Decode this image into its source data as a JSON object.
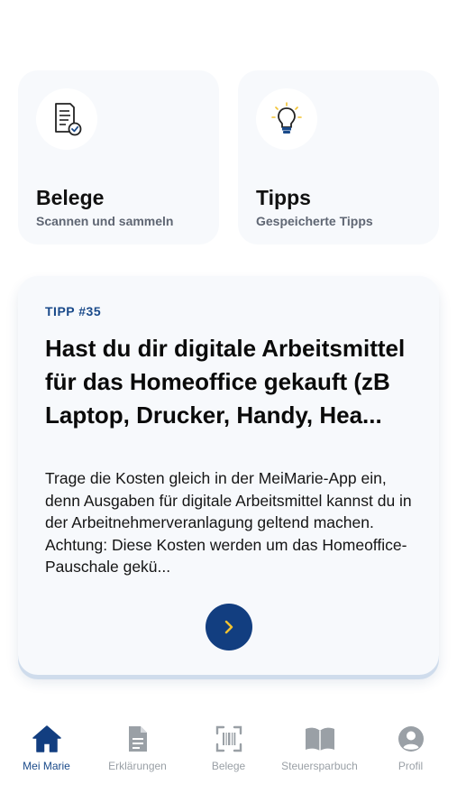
{
  "cards": [
    {
      "title": "Belege",
      "subtitle": "Scannen und sammeln",
      "icon": "receipt-check-icon"
    },
    {
      "title": "Tipps",
      "subtitle": "Gespeicherte Tipps",
      "icon": "lightbulb-icon"
    }
  ],
  "tip": {
    "label": "TIPP #35",
    "headline": "Hast du dir digitale Arbeitsmittel für das Homeoffice gekauft (zB Laptop, Drucker, Handy, Hea...",
    "body": "Trage die Kosten gleich in der MeiMarie-App ein, denn Ausgaben für digitale Arbeitsmittel kannst du in der Arbeitnehmerveranlagung geltend machen. Achtung: Diese Kosten werden um das Homeoffice-Pauschale gekü...",
    "next_icon": "chevron-right-icon"
  },
  "tabbar": {
    "items": [
      {
        "label": "Mei Marie",
        "icon": "home-icon",
        "active": true
      },
      {
        "label": "Erklärungen",
        "icon": "document-icon",
        "active": false
      },
      {
        "label": "Belege",
        "icon": "barcode-scan-icon",
        "active": false
      },
      {
        "label": "Steuersparbuch",
        "icon": "book-icon",
        "active": false
      },
      {
        "label": "Profil",
        "icon": "profile-icon",
        "active": false
      }
    ]
  },
  "colors": {
    "accent": "#123e80",
    "accent_text": "#1a4a8a",
    "chevron": "#f2c230",
    "card_bg": "#f7f9fc",
    "inactive": "#9aa0a6"
  }
}
